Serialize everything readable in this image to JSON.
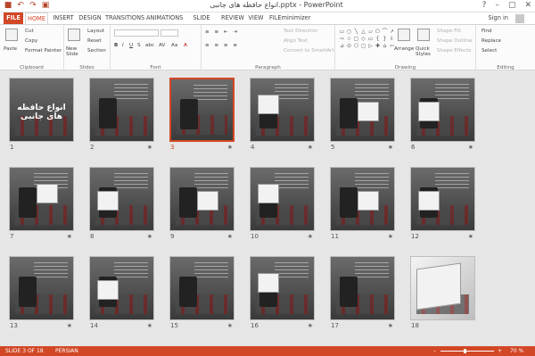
{
  "titlebar": {
    "title": "انواع حافظه های جانبی.pptx - PowerPoint",
    "qat": [
      "save-icon",
      "undo-icon",
      "redo-icon",
      "start-icon"
    ],
    "help": "?",
    "minimize": "–",
    "restore": "▢",
    "close": "✕"
  },
  "tabs": {
    "file": "FILE",
    "items": [
      "HOME",
      "INSERT",
      "DESIGN",
      "TRANSITIONS",
      "ANIMATIONS",
      "SLIDE SHOW",
      "REVIEW",
      "VIEW",
      "FILEminimizer"
    ],
    "active": "HOME",
    "signin": "Sign in"
  },
  "ribbon": {
    "clipboard": {
      "paste": "Paste",
      "cut": "Cut",
      "copy": "Copy",
      "format_painter": "Format Painter",
      "label": "Clipboard"
    },
    "slides": {
      "new_slide": "New Slide",
      "layout": "Layout",
      "reset": "Reset",
      "section": "Section",
      "label": "Slides"
    },
    "font": {
      "label": "Font",
      "bold": "B",
      "italic": "I",
      "underline": "U",
      "strike": "S",
      "shadow": "abc",
      "spacing": "AV",
      "case": "Aa",
      "color": "A"
    },
    "paragraph": {
      "label": "Paragraph",
      "text_direction": "Text Direction",
      "align_text": "Align Text",
      "convert": "Convert to SmartArt"
    },
    "drawing": {
      "label": "Drawing",
      "arrange": "Arrange",
      "quick_styles": "Quick Styles",
      "shape_fill": "Shape Fill",
      "shape_outline": "Shape Outline",
      "shape_effects": "Shape Effects"
    },
    "editing": {
      "label": "Editing",
      "find": "Find",
      "replace": "Replace",
      "select": "Select"
    }
  },
  "slides": [
    {
      "n": "1",
      "title": "انواع حافظه های جانبی",
      "star": ""
    },
    {
      "n": "2",
      "star": "★"
    },
    {
      "n": "3",
      "star": "★",
      "selected": true
    },
    {
      "n": "4",
      "star": "★"
    },
    {
      "n": "5",
      "star": "★"
    },
    {
      "n": "6",
      "star": "★"
    },
    {
      "n": "7",
      "star": "★"
    },
    {
      "n": "8",
      "star": "★"
    },
    {
      "n": "9",
      "star": "★"
    },
    {
      "n": "10",
      "star": "★"
    },
    {
      "n": "11",
      "star": "★"
    },
    {
      "n": "12",
      "star": "★"
    },
    {
      "n": "13",
      "star": "★"
    },
    {
      "n": "14",
      "star": "★"
    },
    {
      "n": "15",
      "star": "★"
    },
    {
      "n": "16",
      "star": "★"
    },
    {
      "n": "17",
      "star": "★"
    },
    {
      "n": "18",
      "star": ""
    }
  ],
  "status": {
    "slide_of": "SLIDE 3 OF 18",
    "language": "PERSIAN",
    "zoom": "70 %",
    "zoom_minus": "–",
    "zoom_plus": "+"
  },
  "colors": {
    "accent": "#d24726"
  }
}
